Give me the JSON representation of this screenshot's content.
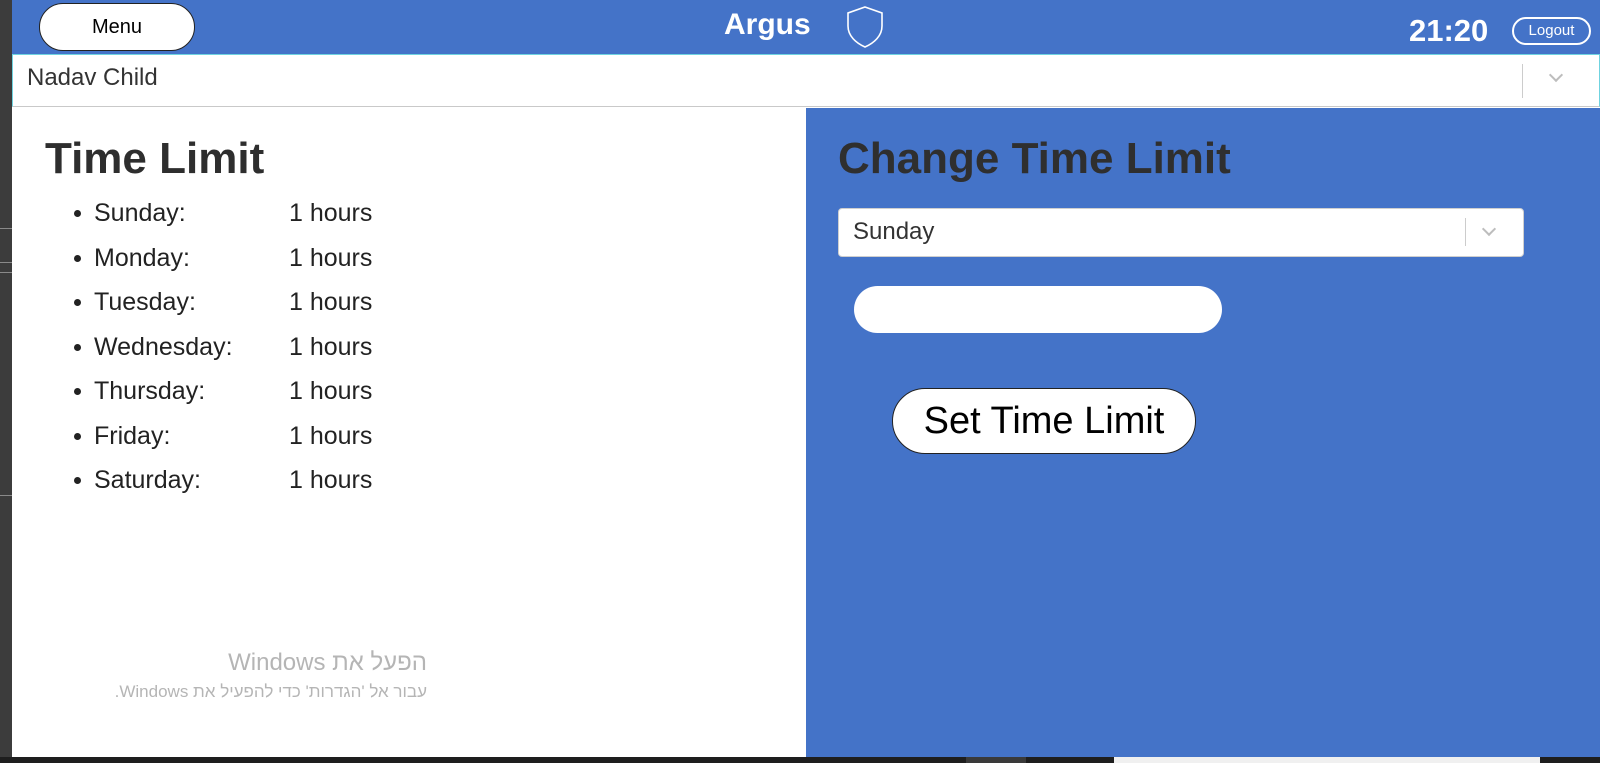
{
  "header": {
    "menu_label": "Menu",
    "brand": "Argus",
    "time": "21:20",
    "logout_label": "Logout",
    "color": "#4473c8"
  },
  "child_select": {
    "value": "Nadav Child"
  },
  "time_limit": {
    "title": "Time Limit",
    "days": [
      {
        "day": "Sunday:",
        "hours": "1 hours"
      },
      {
        "day": "Monday:",
        "hours": "1 hours"
      },
      {
        "day": "Tuesday:",
        "hours": "1 hours"
      },
      {
        "day": "Wednesday:",
        "hours": "1 hours"
      },
      {
        "day": "Thursday:",
        "hours": "1 hours"
      },
      {
        "day": "Friday:",
        "hours": "1 hours"
      },
      {
        "day": "Saturday:",
        "hours": "1 hours"
      }
    ]
  },
  "change_time_limit": {
    "title": "Change Time Limit",
    "day_select_value": "Sunday",
    "hours_input_value": "",
    "hours_input_placeholder": "",
    "button_label": "Set Time Limit"
  },
  "watermark": {
    "line1": "הפעל את Windows",
    "line2": "עבור אל 'הגדרות' כדי להפעיל את Windows."
  },
  "icons": {
    "brand_icon": "shield-icon",
    "dropdown_icon": "chevron-down-icon"
  }
}
